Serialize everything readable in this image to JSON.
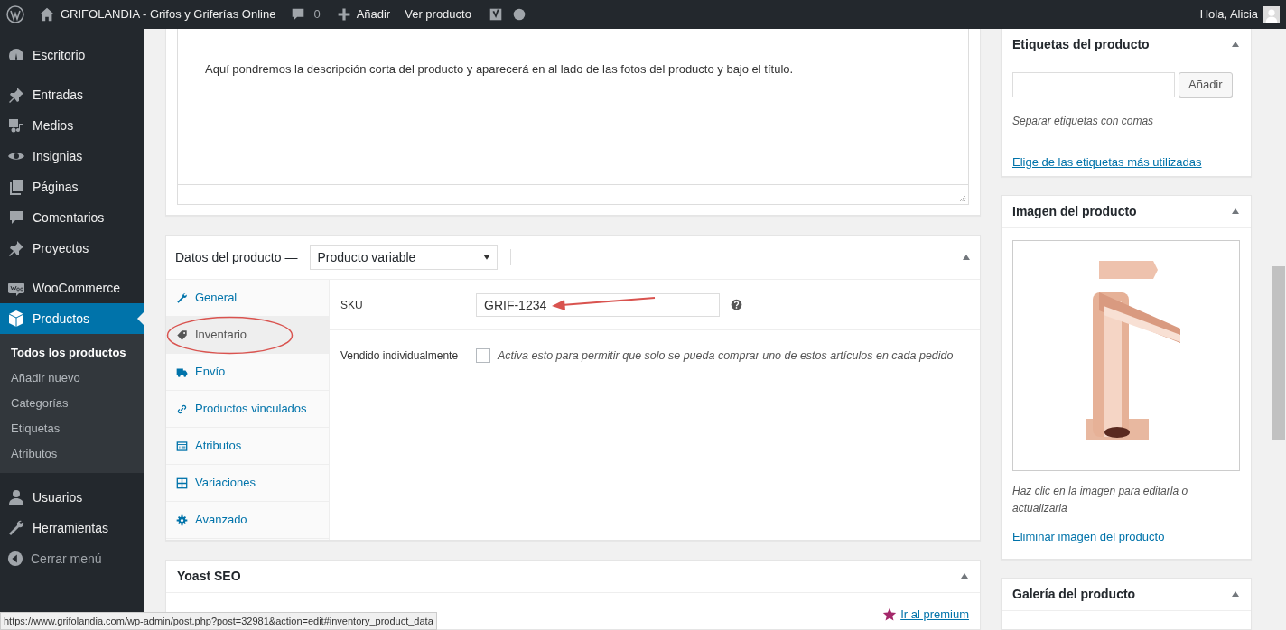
{
  "admin_bar": {
    "site_title": "GRIFOLANDIA - Grifos y Griferías Online",
    "comments_count": "0",
    "new_label": "Añadir",
    "view_label": "Ver producto",
    "greeting": "Hola, Alicia"
  },
  "sidebar": {
    "groups": [
      {
        "items": [
          {
            "label": "Escritorio",
            "kind": "dashboard",
            "selected": false
          }
        ]
      },
      {
        "items": [
          {
            "label": "Entradas",
            "kind": "pin",
            "selected": false
          },
          {
            "label": "Medios",
            "kind": "media",
            "selected": false
          },
          {
            "label": "Insignias",
            "kind": "eye",
            "selected": false
          },
          {
            "label": "Páginas",
            "kind": "pages",
            "selected": false
          },
          {
            "label": "Comentarios",
            "kind": "comment",
            "selected": false
          },
          {
            "label": "Proyectos",
            "kind": "pin",
            "selected": false
          }
        ]
      },
      {
        "items": [
          {
            "label": "WooCommerce",
            "kind": "woo",
            "selected": false
          },
          {
            "label": "Productos",
            "kind": "box",
            "selected": true,
            "children": [
              {
                "label": "Todos los productos",
                "selected": true
              },
              {
                "label": "Añadir nuevo",
                "selected": false
              },
              {
                "label": "Categorías",
                "selected": false
              },
              {
                "label": "Etiquetas",
                "selected": false
              },
              {
                "label": "Atributos",
                "selected": false
              }
            ]
          }
        ]
      },
      {
        "items": [
          {
            "label": "Usuarios",
            "kind": "user",
            "selected": false
          },
          {
            "label": "Herramientas",
            "kind": "wrench",
            "selected": false
          }
        ]
      }
    ],
    "collapse_label": "Cerrar menú"
  },
  "excerpt": {
    "text": "Aquí pondremos la descripción corta del producto y aparecerá en al lado de las fotos del producto y bajo el título."
  },
  "product_data": {
    "title": "Datos del producto —",
    "type_select": "Producto variable",
    "tabs": [
      {
        "label": "General",
        "kind": "wrench",
        "selected": false
      },
      {
        "label": "Inventario",
        "kind": "tag",
        "selected": true
      },
      {
        "label": "Envío",
        "kind": "truck",
        "selected": false
      },
      {
        "label": "Productos vinculados",
        "kind": "link",
        "selected": false
      },
      {
        "label": "Atributos",
        "kind": "list",
        "selected": false
      },
      {
        "label": "Variaciones",
        "kind": "grid",
        "selected": false
      },
      {
        "label": "Avanzado",
        "kind": "gear",
        "selected": false
      }
    ],
    "sku_label": "SKU",
    "sku_value": "GRIF-1234",
    "sold_individually_label": "Vendido individualmente",
    "sold_individually_checked": false,
    "sold_individually_description": "Activa esto para permitir que solo se pueda comprar uno de estos artículos en cada pedido"
  },
  "yoast": {
    "title": "Yoast SEO",
    "premium_link": "Ir al premium"
  },
  "tags_box": {
    "title": "Etiquetas del producto",
    "add_button": "Añadir",
    "hint": "Separar etiquetas con comas",
    "link": "Elige de las etiquetas más utilizadas"
  },
  "image_box": {
    "title": "Imagen del producto",
    "hint": "Haz clic en la imagen para editarla o actualizarla",
    "remove_link": "Eliminar imagen del producto"
  },
  "gallery_box": {
    "title": "Galería del producto"
  },
  "status_url": "https://www.grifolandia.com/wp-admin/post.php?post=32981&action=edit#inventory_product_data"
}
